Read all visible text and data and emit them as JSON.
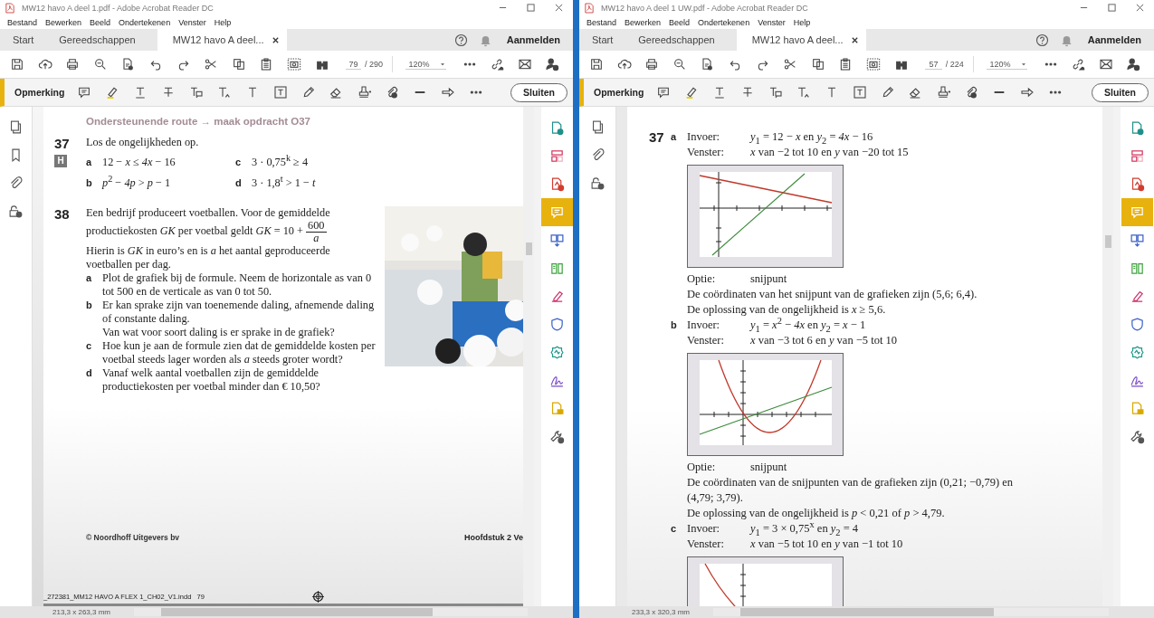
{
  "windows": [
    {
      "title": "MW12 havo A deel 1.pdf - Adobe Acrobat Reader DC",
      "menu": [
        "Bestand",
        "Bewerken",
        "Beeld",
        "Ondertekenen",
        "Venster",
        "Help"
      ],
      "tabs": [
        {
          "label": "Start",
          "selected": false
        },
        {
          "label": "Gereedschappen",
          "selected": false
        },
        {
          "label": "MW12 havo A deel...",
          "selected": true
        }
      ],
      "sign_in": "Aanmelden",
      "page_number": "79",
      "page_total": "/ 290",
      "zoom": "120%",
      "comment_label": "Opmerking",
      "close_button": "Sluiten",
      "nav": [
        {
          "kind": "pages"
        },
        {
          "kind": "bookmarks"
        },
        {
          "kind": "attachments"
        },
        {
          "kind": "security"
        }
      ],
      "tools": [
        {
          "kind": "export",
          "selected": false
        },
        {
          "kind": "organize",
          "selected": false
        },
        {
          "kind": "create",
          "selected": false
        },
        {
          "kind": "comment",
          "selected": true
        },
        {
          "kind": "combine",
          "selected": false
        },
        {
          "kind": "compress",
          "selected": false
        },
        {
          "kind": "fill",
          "selected": false
        },
        {
          "kind": "protect",
          "selected": false
        },
        {
          "kind": "badge",
          "selected": false
        },
        {
          "kind": "sign",
          "selected": false
        },
        {
          "kind": "send",
          "selected": false
        },
        {
          "kind": "more",
          "selected": false
        }
      ],
      "document": {
        "kind": "exercises",
        "route": "Ondersteunende route → maak opdracht O37",
        "exercises": [
          {
            "number": "37",
            "badge": "H",
            "intro": "Los de ongelijkheden op.",
            "grid": [
              {
                "letter": "a",
                "text": "12 − *x* ≤ *4x* − 16"
              },
              {
                "letter": "c",
                "text": "3 · 0,75$^{k}$ ≥ 4"
              },
              {
                "letter": "b",
                "text": "*p*$^{2}$ − *4p* > *p* − 1"
              },
              {
                "letter": "d",
                "text": "3 · 1,8$^{t}$ > 1 − *t*"
              }
            ]
          },
          {
            "number": "38",
            "intro": "Een bedrijf produceert voetballen. Voor de gemiddelde productiekosten *GK* per voetbal geldt *GK* = 10 +",
            "fraction": {
              "numerator": "600",
              "denominator": "*a*"
            },
            "after": "Hierin is *GK* in euro’s en is *a* het aantal geproduceerde voetballen per dag.",
            "items": [
              {
                "letter": "a",
                "text": "Plot de grafiek bij de formule. Neem de horizontale as van 0 tot 500 en de verticale as van 0 tot 50."
              },
              {
                "letter": "b",
                "text": "Er kan sprake zijn van toenemende daling, afnemende daling of constante daling.",
                "question": "Van wat voor soort daling is er sprake in de grafiek?"
              },
              {
                "letter": "c",
                "text": "Hoe kun je aan de formule zien dat de gemiddelde kosten per voetbal steeds lager worden als *a* steeds groter wordt?"
              },
              {
                "letter": "d",
                "text": "Vanaf welk aantal voetballen zijn de gemiddelde productiekosten per voetbal minder dan € 10,50?"
              }
            ]
          }
        ],
        "copyright": "© Noordhoff Uitgevers bv",
        "chapter": "Hoofdstuk 2 Ve",
        "slug": "_272381_MM12 HAVO A FLEX 1_CH02_V1.indd   79"
      },
      "page_size": "213,3 x 263,3 mm"
    },
    {
      "title": "MW12 havo A deel 1 UW.pdf - Adobe Acrobat Reader DC",
      "menu": [
        "Bestand",
        "Bewerken",
        "Beeld",
        "Ondertekenen",
        "Venster",
        "Help"
      ],
      "tabs": [
        {
          "label": "Start",
          "selected": false
        },
        {
          "label": "Gereedschappen",
          "selected": false
        },
        {
          "label": "MW12 havo A deel...",
          "selected": true
        }
      ],
      "sign_in": "Aanmelden",
      "page_number": "57",
      "page_total": "/ 224",
      "zoom": "120%",
      "comment_label": "Opmerking",
      "close_button": "Sluiten",
      "nav": [
        {
          "kind": "pages"
        },
        {
          "kind": "attachments"
        },
        {
          "kind": "security"
        }
      ],
      "tools": [
        {
          "kind": "export",
          "selected": false
        },
        {
          "kind": "organize",
          "selected": false
        },
        {
          "kind": "create",
          "selected": false
        },
        {
          "kind": "comment",
          "selected": true
        },
        {
          "kind": "combine",
          "selected": false
        },
        {
          "kind": "compress",
          "selected": false
        },
        {
          "kind": "fill",
          "selected": false
        },
        {
          "kind": "protect",
          "selected": false
        },
        {
          "kind": "badge",
          "selected": false
        },
        {
          "kind": "sign",
          "selected": false
        },
        {
          "kind": "send",
          "selected": false
        },
        {
          "kind": "more",
          "selected": false
        }
      ],
      "document": {
        "kind": "answers",
        "number": "37",
        "parts": [
          {
            "letter": "a",
            "input_rows": [
              {
                "label": "Invoer:",
                "value": "*y*$_{1}$ = 12 − *x* en *y*$_{2}$ = *4x* − 16"
              },
              {
                "label": "Venster:",
                "value": "*x* van −2 tot 10 en *y* van −20 tot 15"
              }
            ],
            "graph": {
              "kind": "lines"
            },
            "output_rows": [
              {
                "label": "Optie:",
                "value": "snijpunt"
              }
            ],
            "sentences": [
              "De coördinaten van het snijpunt van de grafieken zijn (5,6; 6,4).",
              "De oplossing van de ongelijkheid is *x* ≥ 5,6."
            ]
          },
          {
            "letter": "b",
            "input_rows": [
              {
                "label": "Invoer:",
                "value": "*y*$_{1}$ = *x*$^{2}$ − *4x* en *y*$_{2}$ = *x* − 1"
              },
              {
                "label": "Venster:",
                "value": "*x* van −3 tot 6 en *y* van −5 tot 10"
              }
            ],
            "graph": {
              "kind": "parabola"
            },
            "output_rows": [
              {
                "label": "Optie:",
                "value": "snijpunt"
              }
            ],
            "sentences": [
              "De coördinaten van de snijpunten van de grafieken zijn (0,21; −0,79) en (4,79; 3,79).",
              "De oplossing van de ongelijkheid is *p* < 0,21 of *p* > 4,79."
            ]
          },
          {
            "letter": "c",
            "input_rows": [
              {
                "label": "Invoer:",
                "value": "*y*$_{1}$ = 3 × 0,75$^{x}$ en *y*$_{2}$ = 4"
              },
              {
                "label": "Venster:",
                "value": "*x* van −5 tot 10 en *y* van −1 tot 10"
              }
            ],
            "graph": {
              "kind": "exponential"
            }
          }
        ]
      },
      "page_size": "233,3 x 320,3 mm"
    }
  ]
}
